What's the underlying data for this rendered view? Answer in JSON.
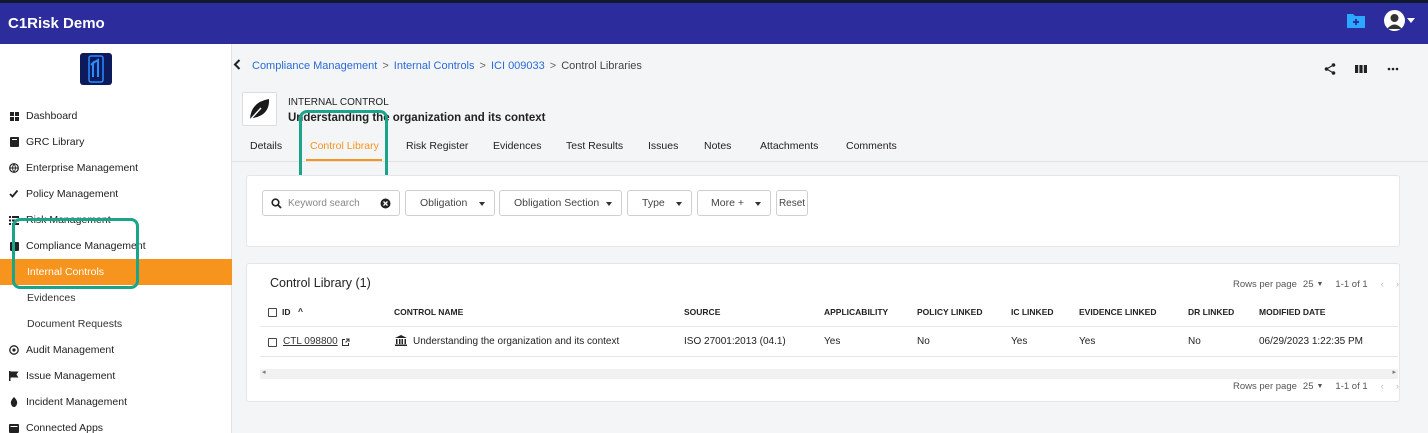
{
  "app": {
    "title": "C1Risk Demo"
  },
  "topbar": {
    "folder_icon": "folder-add-icon",
    "avatar_icon": "user-avatar-icon"
  },
  "sidebar": {
    "items": [
      {
        "label": "Dashboard",
        "icon": "grid-icon"
      },
      {
        "label": "GRC Library",
        "icon": "book-icon"
      },
      {
        "label": "Enterprise Management",
        "icon": "globe-icon"
      },
      {
        "label": "Policy Management",
        "icon": "check-list-icon"
      },
      {
        "label": "Risk Management",
        "icon": "list-icon"
      },
      {
        "label": "Compliance Management",
        "icon": "clipboard-icon"
      },
      {
        "label": "Internal Controls",
        "sub": true,
        "active": true
      },
      {
        "label": "Evidences",
        "sub": true
      },
      {
        "label": "Document Requests",
        "sub": true
      },
      {
        "label": "Audit Management",
        "icon": "target-icon"
      },
      {
        "label": "Issue Management",
        "icon": "flag-icon"
      },
      {
        "label": "Incident Management",
        "icon": "fire-icon"
      },
      {
        "label": "Connected Apps",
        "icon": "apps-icon"
      }
    ]
  },
  "breadcrumb": {
    "items": [
      "Compliance Management",
      "Internal Controls",
      "ICI 009033"
    ],
    "current": "Control Libraries",
    "separator": ">"
  },
  "record": {
    "type": "INTERNAL CONTROL",
    "title": "Understanding the organization and its context",
    "icon": "leaf-icon"
  },
  "tabs": [
    "Details",
    "Control Library",
    "Risk Register",
    "Evidences",
    "Test Results",
    "Issues",
    "Notes",
    "Attachments",
    "Comments"
  ],
  "active_tab": "Control Library",
  "filters": {
    "search_placeholder": "Keyword search",
    "dropdowns": [
      "Obligation",
      "Obligation Section",
      "Type",
      "More +"
    ],
    "reset": "Reset"
  },
  "table": {
    "title": "Control Library (1)",
    "rows_per_page_label": "Rows per page",
    "rows_per_page": "25",
    "range": "1-1 of 1",
    "columns": [
      "ID",
      "CONTROL NAME",
      "SOURCE",
      "APPLICABILITY",
      "POLICY LINKED",
      "IC LINKED",
      "EVIDENCE LINKED",
      "DR LINKED",
      "MODIFIED DATE"
    ],
    "sort_indicator": "^",
    "rows": [
      {
        "id": "CTL 098800",
        "control_name": "Understanding the organization and its context",
        "source": "ISO 27001:2013 (04.1)",
        "applicability": "Yes",
        "policy_linked": "No",
        "ic_linked": "Yes",
        "evidence_linked": "Yes",
        "dr_linked": "No",
        "modified_date": "06/29/2023 1:22:35 PM"
      }
    ]
  },
  "colors": {
    "topbar": "#2c2c9c",
    "accent": "#f7941d",
    "highlight": "#1aa58a",
    "link": "#2a6ad9"
  }
}
